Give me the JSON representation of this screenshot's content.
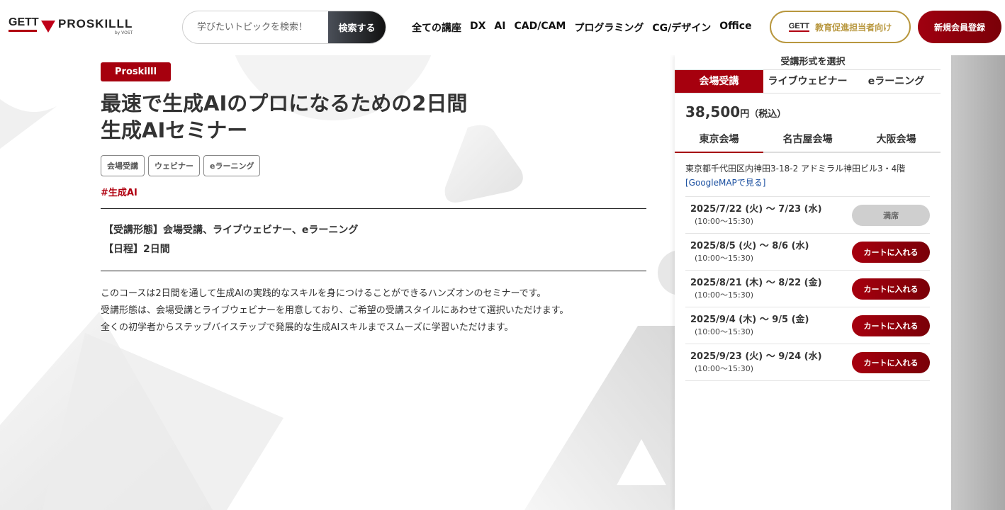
{
  "header": {
    "logo_gett": "GETT",
    "logo_proskill": "PROSKILLL",
    "logo_sub": "by VOST",
    "search_placeholder": "学びたいトピックを検索！",
    "search_button": "検索する",
    "nav": [
      "全ての講座",
      "DX",
      "AI",
      "CAD/CAM",
      "プログラミング",
      "CG/デザイン",
      "Office"
    ],
    "corp_logo": "GETT",
    "corp_button": "教育促進担当者向け",
    "join_button": "新規会員登録"
  },
  "course": {
    "badge": "Proskilll",
    "title_line1": "最速で生成AIのプロになるための2日間",
    "title_line2": "生成AIセミナー",
    "tags": [
      "会場受講",
      "ウェビナー",
      "eラーニング"
    ],
    "hashtag": "#生成AI",
    "format_line": "【受講形態】会場受講、ライブウェビナー、eラーニング",
    "schedule_line": "【日程】2日間",
    "description": [
      "このコースは2日間を通して生成AIの実践的なスキルを身につけることができるハンズオンのセミナーです。",
      "受講形態は、会場受講とライブウェビナーを用意しており、ご希望の受講スタイルにあわせて選択いただけます。",
      "全くの初学者からステップバイステップで発展的な生成AIスキルまでスムーズに学習いただけます。"
    ]
  },
  "panel": {
    "title": "受講形式を選択",
    "mode_tabs": [
      "会場受講",
      "ライブウェビナー",
      "eラーニング"
    ],
    "price": "38,500",
    "price_unit": "円",
    "price_tax": "（税込）",
    "venue_tabs": [
      "東京会場",
      "名古屋会場",
      "大阪会場"
    ],
    "address": "東京都千代田区内神田3-18-2 アドミラル神田ビル3・4階",
    "map_link": "[GoogleMAPで見る]",
    "dates": [
      {
        "date": "2025/7/22 (火) ～ 7/23 (水)",
        "time": "(10:00～15:30)",
        "button": "満席",
        "status": "full"
      },
      {
        "date": "2025/8/5 (火) ～ 8/6 (水)",
        "time": "(10:00～15:30)",
        "button": "カートに入れる",
        "status": "cart"
      },
      {
        "date": "2025/8/21 (木) ～ 8/22 (金)",
        "time": "(10:00～15:30)",
        "button": "カートに入れる",
        "status": "cart"
      },
      {
        "date": "2025/9/4 (木) ～ 9/5 (金)",
        "time": "(10:00～15:30)",
        "button": "カートに入れる",
        "status": "cart"
      },
      {
        "date": "2025/9/23 (火) ～ 9/24 (水)",
        "time": "(10:00～15:30)",
        "button": "カートに入れる",
        "status": "cart"
      }
    ]
  },
  "colors": {
    "brand_red": "#a6000e",
    "gold": "#b8973e",
    "link_blue": "#1a4fa0"
  }
}
